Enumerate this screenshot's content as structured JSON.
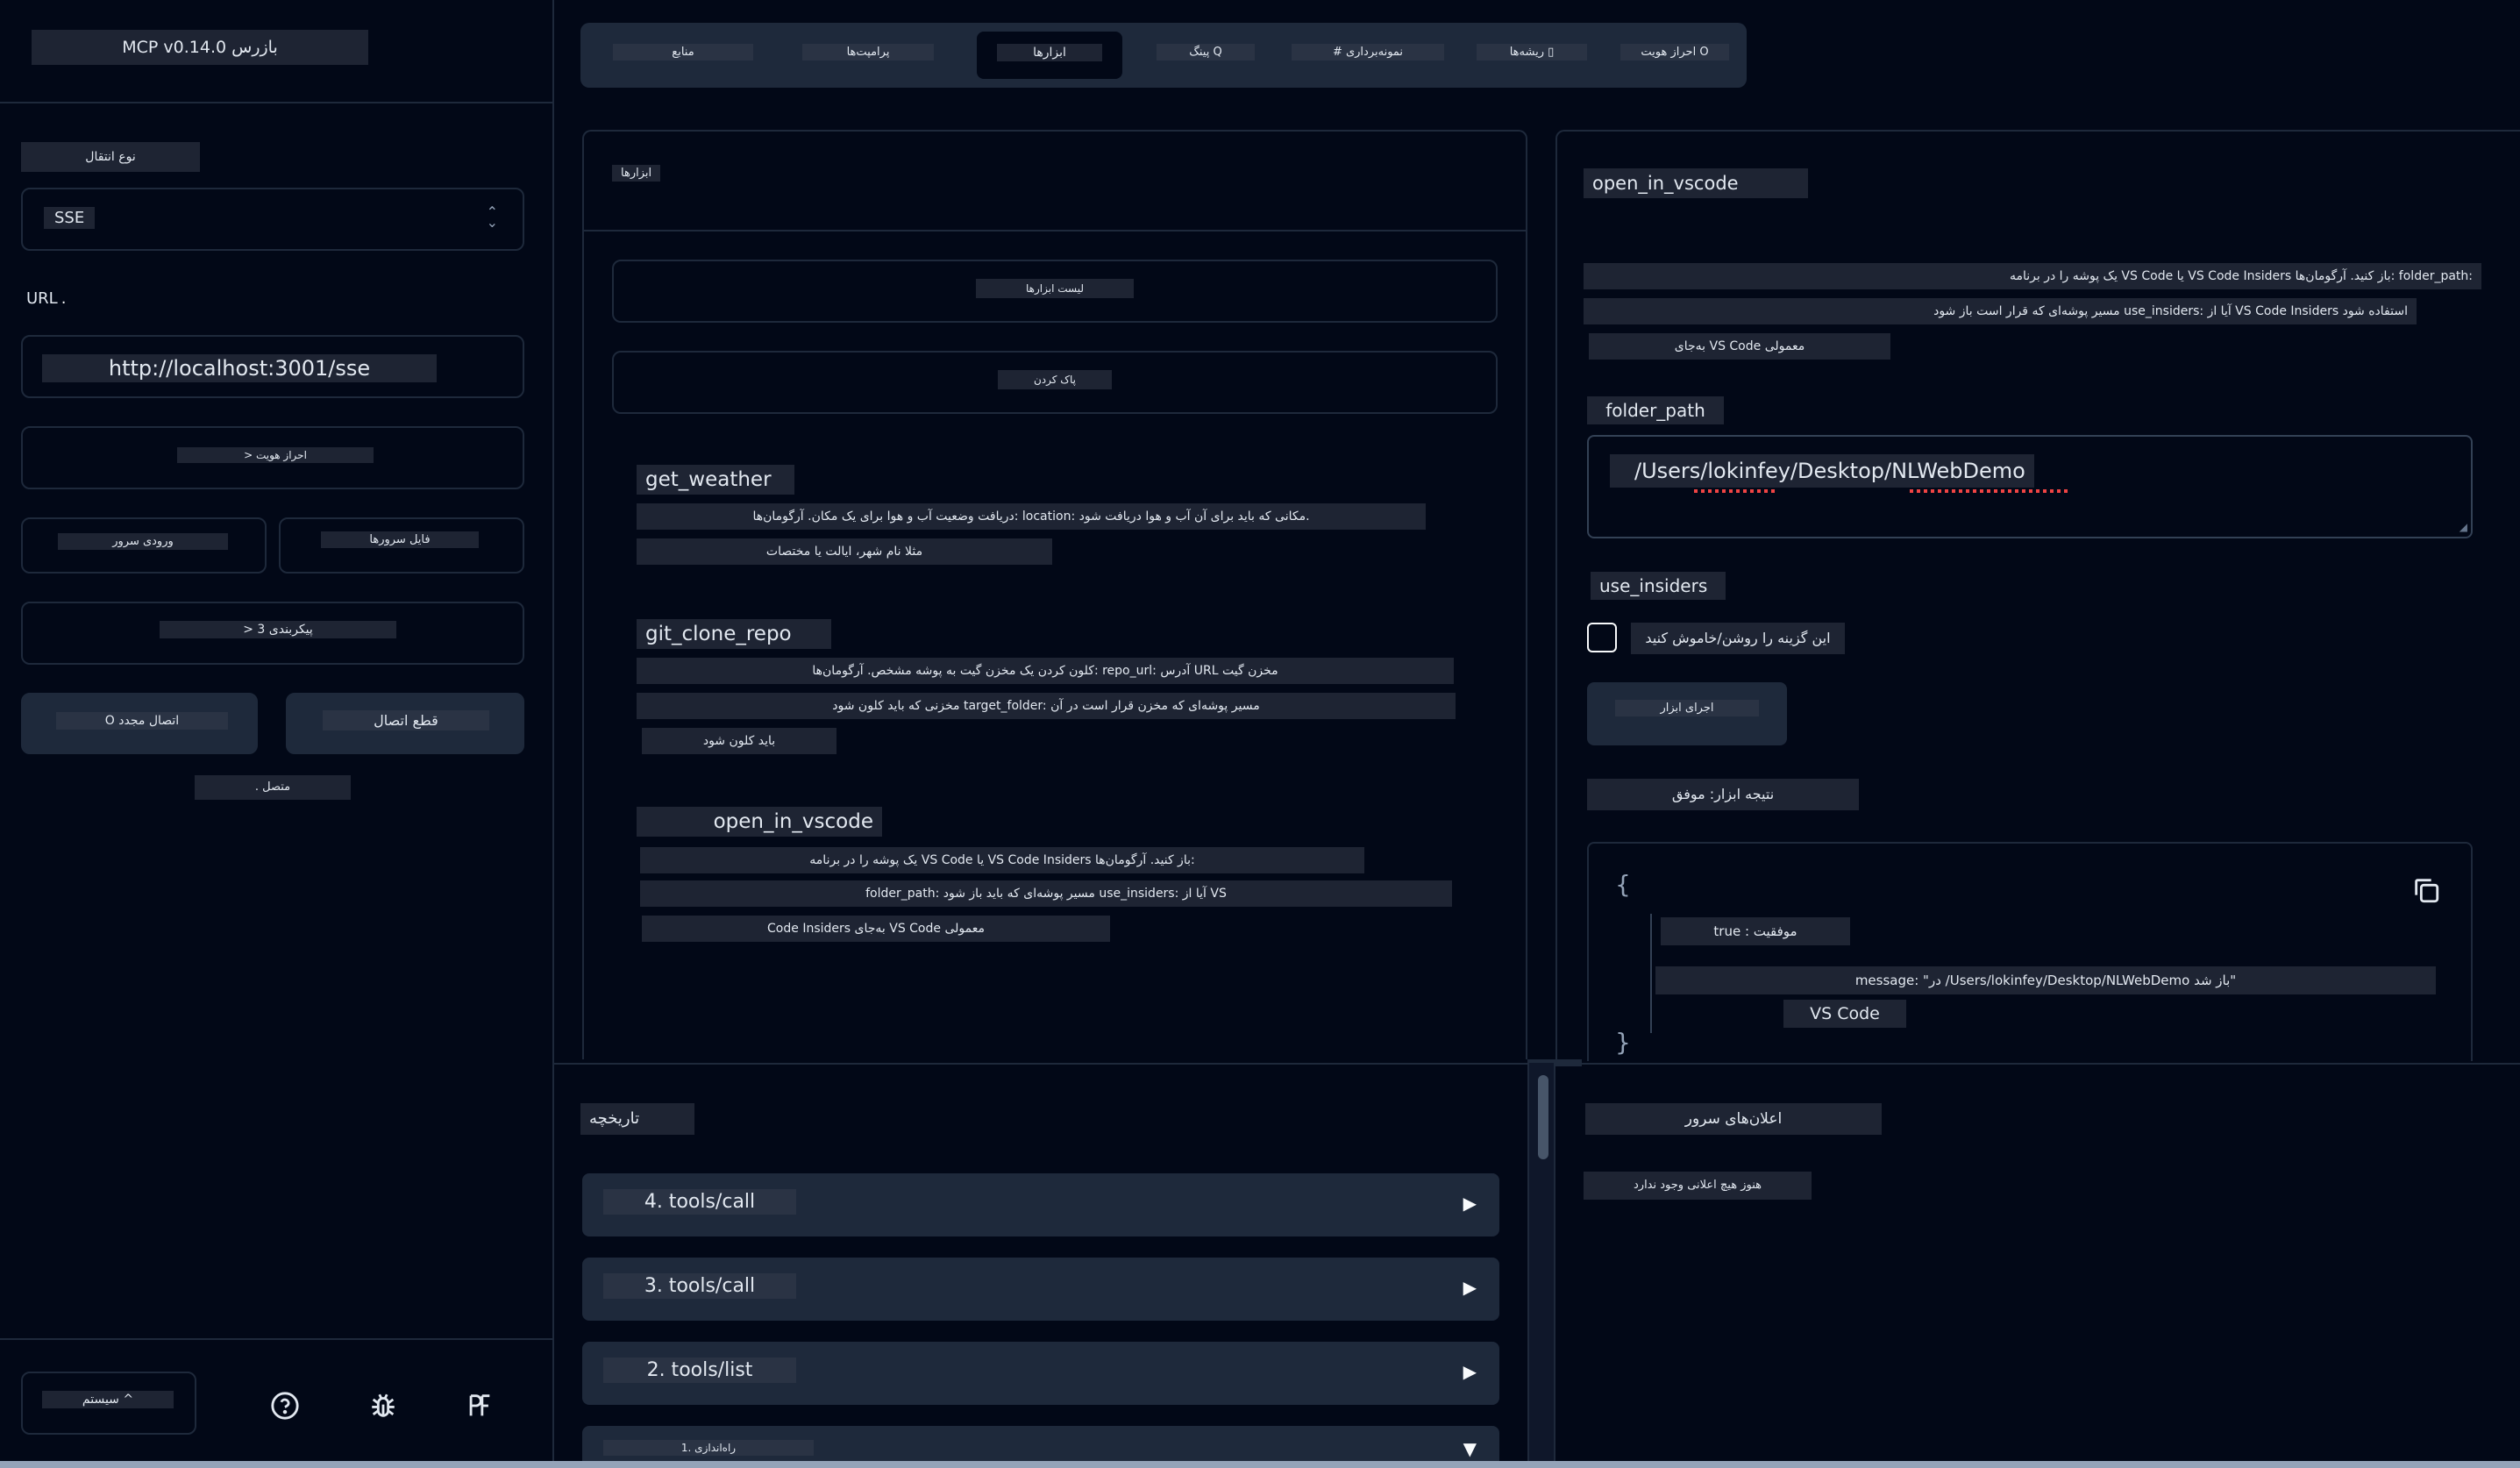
{
  "app": {
    "title": "MCP v0.14.0 بازرس"
  },
  "sidebar": {
    "transport_label": "نوع انتقال",
    "transport_value": "SSE",
    "url_label": "URL",
    "url_value": "http://localhost:3001/sse",
    "auth_button": "> احراز هویت",
    "env_button": "ورودی سرور",
    "server_file_button": "فایل سرورها",
    "config_button": "> 3 پیکربندی",
    "reconnect_button": "O اتصال مجدد",
    "disconnect_button": "قطع اتصال",
    "status": ". متصل",
    "system_button": "سیستم ^"
  },
  "tabs": [
    {
      "label": "منابع",
      "active": false
    },
    {
      "label": "پرامپت‌ها",
      "active": false
    },
    {
      "label": "ابزارها",
      "active": true
    },
    {
      "label": "پینگ Q",
      "active": false
    },
    {
      "label": "# نمونه‌برداری",
      "active": false
    },
    {
      "label": "ریشه‌ها ▯",
      "active": false
    },
    {
      "label": "احراز هویت O",
      "active": false
    }
  ],
  "tools_panel": {
    "title": "ابزارها",
    "list_button": "لیست ابزارها",
    "clear_button": "پاک کردن",
    "tools": [
      {
        "name": "get_weather",
        "lines": [
          "دریافت وضعیت آب و هوا برای یک مکان. آرگومان‌ها: location: مکانی که باید برای آن آب و هوا دریافت شود.",
          "مثلا نام شهر، ایالت یا مختصات"
        ]
      },
      {
        "name": "git_clone_repo",
        "lines": [
          "کلون کردن یک مخزن گیت به پوشه مشخص. آرگومان‌ها: repo_url: آدرس URL مخزن گیت",
          "مخزنی که باید کلون شود target_folder: مسیر پوشه‌ای که مخزن قرار است در آن",
          "باید کلون شود"
        ]
      },
      {
        "name": "open_in_vscode",
        "lines": [
          "یک پوشه را در برنامه VS Code یا VS Code Insiders باز کنید. آرگومان‌ها:",
          "folder_path: مسیر پوشه‌ای که باید باز شود use_insiders: آیا از VS",
          "Code Insiders به‌جای VS Code معمولی"
        ]
      }
    ]
  },
  "detail": {
    "title": "open_in_vscode",
    "desc_lines": [
      "یک پوشه را در برنامه VS Code یا VS Code Insiders باز کنید. آرگومان‌ها: folder_path:",
      "مسیر پوشه‌ای که قرار است باز شود use_insiders: آیا از VS Code Insiders استفاده شود",
      "به‌جای VS Code معمولی"
    ],
    "folder_path_label": "folder_path",
    "folder_path_value": "/Users/lokinfey/Desktop/NLWebDemo",
    "use_insiders_label": "use_insiders",
    "use_insiders_checked": false,
    "use_insiders_toggle_text": "این گزینه را روشن/خاموش کنید",
    "run_button": "اجرای ابزار",
    "result_label": "نتیجه ابزار: موفق",
    "result": {
      "open_brace": "{",
      "success_line": "true : موفقیت",
      "message_line": "message: \"در /Users/lokinfey/Desktop/NLWebDemo باز شد\"",
      "message_cont": "VS Code",
      "close_brace": "}"
    }
  },
  "history": {
    "title": "تاریخچه",
    "items": [
      {
        "label": "4. tools/call",
        "expanded": false
      },
      {
        "label": "3. tools/call",
        "expanded": false
      },
      {
        "label": "2. tools/list",
        "expanded": false
      },
      {
        "label": "1. راه‌اندازی",
        "expanded": true
      }
    ]
  },
  "notifications": {
    "title": "اعلان‌های سرور",
    "empty_text": "هنوز هیچ اعلانی وجود ندارد"
  }
}
